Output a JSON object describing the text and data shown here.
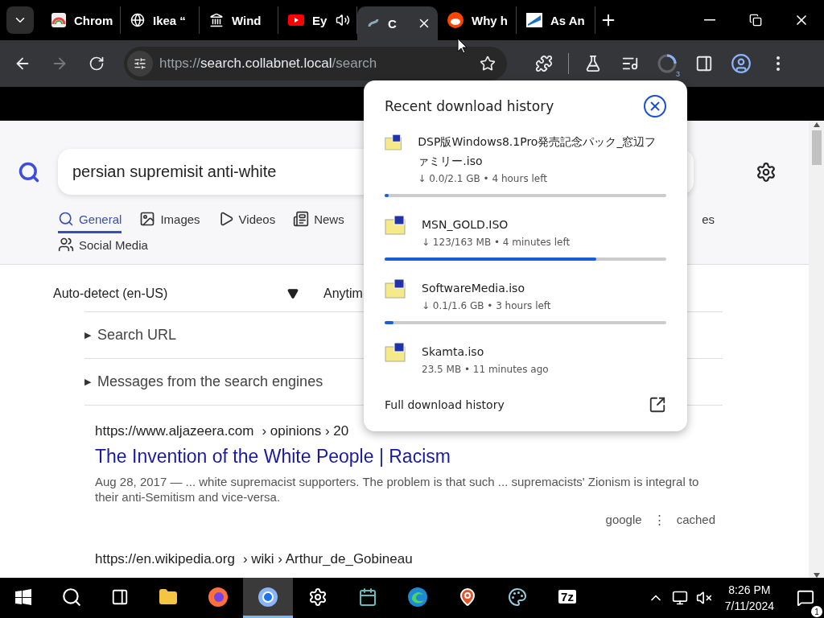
{
  "tabs": [
    {
      "title": "Chrom",
      "selected": false,
      "audio": false
    },
    {
      "title": "Ikea “",
      "selected": false,
      "audio": false
    },
    {
      "title": "Wind",
      "selected": false,
      "audio": false
    },
    {
      "title": "Ey",
      "selected": false,
      "audio": true
    },
    {
      "title": "C",
      "selected": true,
      "audio": false
    },
    {
      "title": "Why h",
      "selected": false,
      "audio": false
    },
    {
      "title": "As An",
      "selected": false,
      "audio": false
    }
  ],
  "address_bar": {
    "scheme": "https://",
    "host": "search.collabnet.local",
    "path": "/search"
  },
  "toolbar": {
    "download_badge": "3"
  },
  "search": {
    "value": "persian supremisit anti-white"
  },
  "categories": [
    {
      "label": "General",
      "selected": true
    },
    {
      "label": "Images",
      "selected": false
    },
    {
      "label": "Videos",
      "selected": false
    },
    {
      "label": "News",
      "selected": false
    },
    {
      "label": "es",
      "selected": false
    },
    {
      "label": "Social Media",
      "selected": false
    }
  ],
  "filters": {
    "language": "Auto-detect (en-US)",
    "time": "Anytim"
  },
  "sections": [
    {
      "caret": "▶",
      "label": "Search URL",
      "expanded": false
    },
    {
      "caret": "▶",
      "label": "Messages from the search engines",
      "expanded": false
    }
  ],
  "results": [
    {
      "url": "https://www.aljazeera.com",
      "path": "› opinions › 20",
      "title": "The Invention of the White People | Racism",
      "snippet": "Aug 28, 2017 — ... white supremacist supporters. The problem is that such ... supremacists' Zionism is integral to their anti-Semitism and vice-versa.",
      "engine": "google",
      "menu": "⋮",
      "cached": "cached"
    },
    {
      "url": "https://en.wikipedia.org",
      "path": "› wiki › Arthur_de_Gobineau"
    }
  ],
  "downloads": {
    "title": "Recent download history",
    "items": [
      {
        "name": "DSP版Windows8.1Pro発売記念パック_窓辺ファミリー.iso",
        "status": "↓ 0.0/2.1 GB • 4 hours left",
        "kind": "active",
        "level": 0.01
      },
      {
        "name": "MSN_GOLD.ISO",
        "status": "↓ 123/163 MB • 4 minutes left",
        "kind": "active",
        "level": 0.75
      },
      {
        "name": "SoftwareMedia.iso",
        "status": "↓ 0.1/1.6 GB • 3 hours left",
        "kind": "active",
        "level": 0.03
      },
      {
        "name": "Skamta.iso",
        "status": "23.5 MB • 11 minutes ago",
        "kind": "done"
      }
    ],
    "footer": "Full download history"
  },
  "taskbar": {
    "apps": [
      {
        "active": false
      },
      {
        "active": false
      },
      {
        "active": true
      },
      {
        "active": false
      },
      {
        "active": false
      },
      {
        "active": false
      },
      {
        "active": false
      },
      {
        "active": false
      },
      {
        "label": "7z",
        "active": false
      }
    ],
    "time": "8:26 PM",
    "date": "7/11/2024",
    "notifications": "1"
  }
}
